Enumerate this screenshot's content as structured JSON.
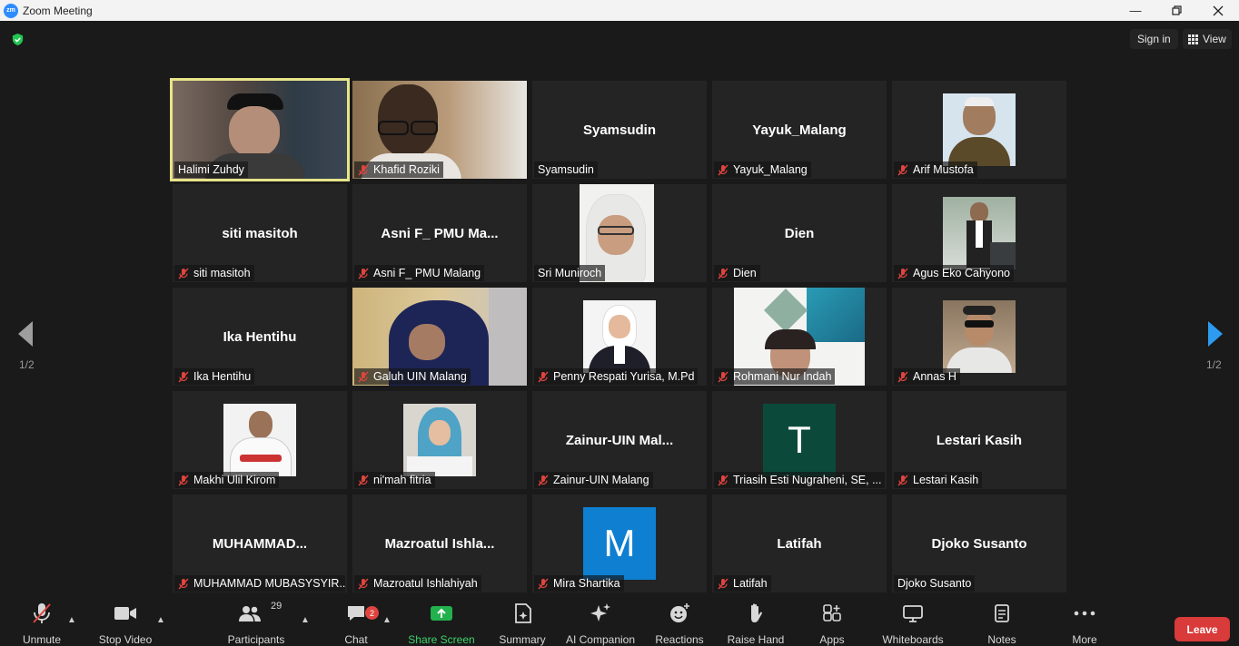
{
  "window": {
    "title": "Zoom Meeting",
    "logo_text": "zm"
  },
  "header": {
    "signin_label": "Sign in",
    "view_label": "View"
  },
  "pager": {
    "left": "1/2",
    "right": "1/2"
  },
  "tiles": [
    {
      "big": "",
      "label": "Halimi Zuhdy",
      "muted": false,
      "video": "halimi"
    },
    {
      "big": "",
      "label": "Khafid Roziki",
      "muted": true,
      "video": "khafid"
    },
    {
      "big": "Syamsudin",
      "label": "Syamsudin",
      "muted": false,
      "video": ""
    },
    {
      "big": "Yayuk_Malang",
      "label": "Yayuk_Malang",
      "muted": true,
      "video": ""
    },
    {
      "big": "",
      "label": "Arif Mustofa",
      "muted": true,
      "video": "arif"
    },
    {
      "big": "siti masitoh",
      "label": "siti masitoh",
      "muted": true,
      "video": ""
    },
    {
      "big": "Asni F_ PMU Ma...",
      "label": "Asni F_ PMU Malang",
      "muted": true,
      "video": ""
    },
    {
      "big": "",
      "label": "Sri Muniroch",
      "muted": false,
      "video": "sri"
    },
    {
      "big": "Dien",
      "label": "Dien",
      "muted": true,
      "video": ""
    },
    {
      "big": "",
      "label": "Agus Eko Cahyono",
      "muted": true,
      "video": "agus"
    },
    {
      "big": "Ika Hentihu",
      "label": "Ika Hentihu",
      "muted": true,
      "video": ""
    },
    {
      "big": "",
      "label": "Galuh UIN Malang",
      "muted": true,
      "video": "galuh"
    },
    {
      "big": "",
      "label": "Penny Respati Yurisa, M.Pd",
      "muted": true,
      "video": "penny"
    },
    {
      "big": "",
      "label": "Rohmani Nur Indah",
      "muted": true,
      "video": "rohmani"
    },
    {
      "big": "",
      "label": "Annas H",
      "muted": true,
      "video": "annas"
    },
    {
      "big": "",
      "label": "Makhi Ulil Kirom",
      "muted": true,
      "video": "makhi"
    },
    {
      "big": "",
      "label": "ni'mah fitria",
      "muted": true,
      "video": "nimah"
    },
    {
      "big": "Zainur-UIN  Mal...",
      "label": "Zainur-UIN Malang",
      "muted": true,
      "video": ""
    },
    {
      "big": "",
      "label": "Triasih Esti Nugraheni, SE, ...",
      "muted": true,
      "video": "triasih",
      "letter": "T",
      "letter_color": "#0b4a3a"
    },
    {
      "big": "Lestari Kasih",
      "label": "Lestari Kasih",
      "muted": true,
      "video": ""
    },
    {
      "big": "MUHAMMAD...",
      "label": "MUHAMMAD MUBASYSYIR...",
      "muted": true,
      "video": ""
    },
    {
      "big": "Mazroatul  Ishla...",
      "label": "Mazroatul Ishlahiyah",
      "muted": true,
      "video": ""
    },
    {
      "big": "",
      "label": "Mira Shartika",
      "muted": true,
      "video": "mira",
      "letter": "M",
      "letter_color": "#0e7fd1"
    },
    {
      "big": "Latifah",
      "label": "Latifah",
      "muted": true,
      "video": ""
    },
    {
      "big": "Djoko Susanto",
      "label": "Djoko Susanto",
      "muted": false,
      "video": ""
    }
  ],
  "toolbar": {
    "unmute": "Unmute",
    "stop_video": "Stop Video",
    "participants": "Participants",
    "participants_count": "29",
    "chat": "Chat",
    "chat_badge": "2",
    "share_screen": "Share Screen",
    "summary": "Summary",
    "ai_companion": "AI Companion",
    "reactions": "Reactions",
    "raise_hand": "Raise Hand",
    "apps": "Apps",
    "whiteboards": "Whiteboards",
    "notes": "Notes",
    "more": "More",
    "leave": "Leave"
  },
  "colors": {
    "accent": "#2d8cff",
    "share_green": "#22b14c",
    "leave_red": "#d93a3a",
    "active_border": "#e8e48a"
  }
}
